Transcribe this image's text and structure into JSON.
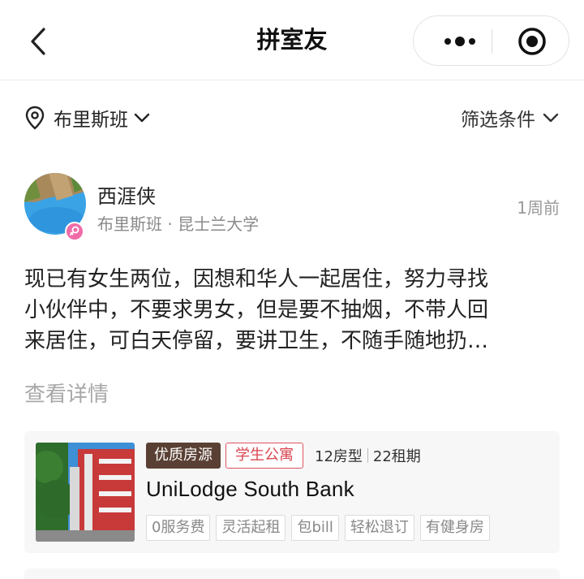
{
  "navbar": {
    "title": "拼室友",
    "back_icon": "chevron-left-icon",
    "more_icon": "more-dots-icon",
    "close_icon": "miniapp-close-icon"
  },
  "filters": {
    "location": "布里斯班",
    "location_icon": "map-pin-icon",
    "filter_label": "筛选条件",
    "dropdown_icon": "chevron-down-icon"
  },
  "post": {
    "username": "西涯侠",
    "subtitle": "布里斯班 · 昆士兰大学",
    "time": "1周前",
    "body_lines": [
      "现已有女生两位，因想和华人一起居住，努力寻找",
      "小伙伴中，不要求男女，但是要不抽烟，不带人回",
      "来居住，可白天停留，要讲卫生，不随手随地扔…"
    ],
    "see_more": "查看详情"
  },
  "property": {
    "tag_premium": "优质房源",
    "tag_type": "学生公寓",
    "room_types": "12房型",
    "leases": "22租期",
    "name": "UniLodge South Bank",
    "features": [
      "0服务费",
      "灵活起租",
      "包bill",
      "轻松退订",
      "有健身房"
    ]
  },
  "colors": {
    "premium_tag_bg": "#5a4034",
    "student_tag_red": "#d8444f",
    "muted_text": "#8a8a8a"
  }
}
